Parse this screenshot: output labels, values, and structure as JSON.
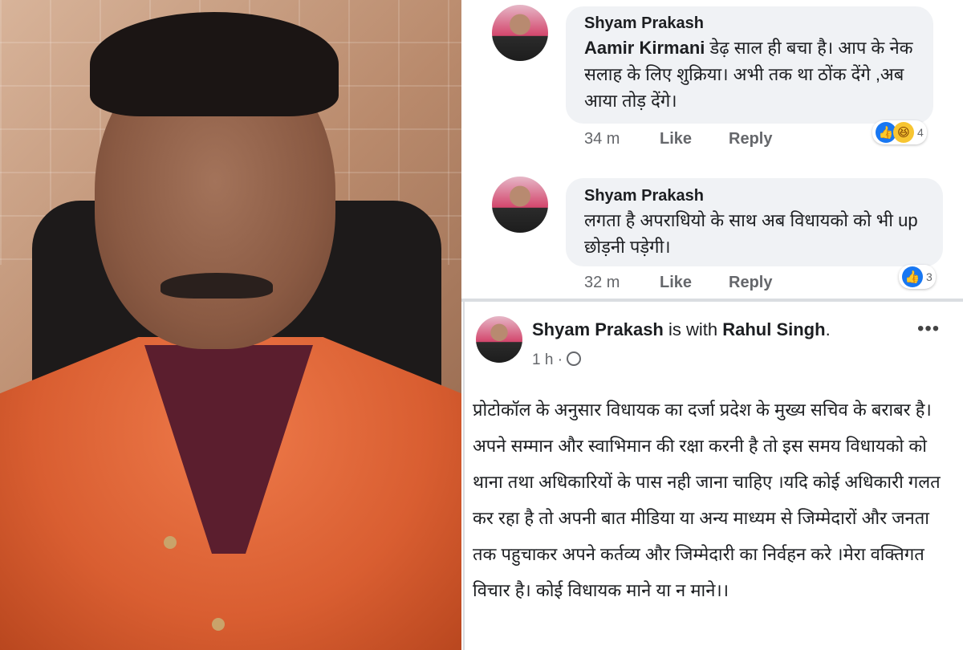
{
  "comments": [
    {
      "author": "Shyam Prakash",
      "mention": "Aamir Kirmani",
      "text": " डेढ़ साल ही बचा है। आप के नेक सलाह के लिए शुक्रिया। अभी तक था ठोंक देंगे ,अब आया तोड़ देंगे।",
      "time": "34 m",
      "like_label": "Like",
      "reply_label": "Reply",
      "reaction_count": "4"
    },
    {
      "author": "Shyam Prakash",
      "text": "लगता है अपराधियो के साथ अब विधायको को भी up छोड़नी पड़ेगी।",
      "time": "32 m",
      "like_label": "Like",
      "reply_label": "Reply",
      "reaction_count": "3"
    }
  ],
  "post": {
    "author": "Shyam Prakash",
    "with_text": " is with ",
    "tagged": "Rahul Singh",
    "suffix": ".",
    "time": "1 h · ",
    "privacy_icon": "globe-icon",
    "more_label": "•••",
    "body": "प्रोटोकॉल के अनुसार विधायक का दर्जा प्रदेश के मुख्य सचिव के बराबर है। अपने सम्मान और स्वाभिमान की रक्षा करनी है तो इस समय विधायको को थाना तथा अधिकारियों के पास नही जाना चाहिए ।यदि कोई अधिकारी गलत कर रहा है तो अपनी बात मीडिया या अन्य माध्यम से जिम्मेदारों और जनता तक पहुचाकर अपने कर्तव्य और जिम्मेदारी का निर्वहन करे ।मेरा वक्तिगत विचार है। कोई विधायक माने या न माने।।"
  },
  "colors": {
    "accent": "#1877f2",
    "bubble": "#f0f2f5",
    "meta": "#65676b"
  }
}
